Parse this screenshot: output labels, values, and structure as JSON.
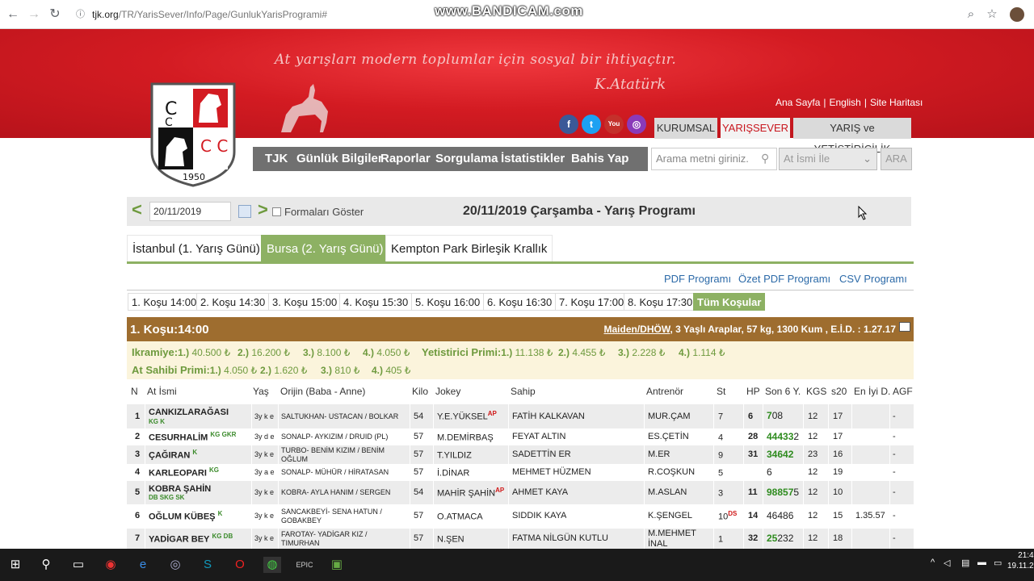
{
  "browser": {
    "url_host": "tjk.org",
    "url_path": "/TR/YarisSever/Info/Page/GunlukYarisProgrami#",
    "watermark": "www.BANDICAM.com"
  },
  "banner": {
    "slogan": "At yarışları modern toplumlar için sosyal bir ihtiyaçtır.",
    "signature": "K.Atatürk",
    "top_links": [
      "Ana Sayfa",
      "English",
      "Site Haritası"
    ],
    "social": [
      "f",
      "t",
      "You Tube",
      "◎"
    ],
    "site_tabs": [
      "KURUMSAL",
      "YARIŞSEVER",
      "YARIŞ ve YETİŞTİRİCİLİK"
    ],
    "logo_year": "1950"
  },
  "colors": {
    "brand_red": "#d31b22",
    "green": "#8db163",
    "race_head": "#9e6d2f"
  },
  "main_nav": [
    "TJK",
    "Günlük Bilgiler",
    "Raporlar",
    "Sorgulama",
    "İstatistikler",
    "Bahis Yap"
  ],
  "search": {
    "placeholder": "Arama metni giriniz.",
    "select_value": "At İsmi İle",
    "button": "ARA"
  },
  "datebar": {
    "date": "20/11/2019",
    "checkbox_label": "Formaları Göster",
    "title": "20/11/2019 Çarşamba - Yarış Programı"
  },
  "city_tabs": [
    "İstanbul (1. Yarış Günü)",
    "Bursa (2. Yarış Günü)",
    "Kempton Park Birleşik Krallık"
  ],
  "program_links": [
    "PDF Programı",
    "Özet PDF Programı",
    "CSV Programı"
  ],
  "race_tabs": [
    "1. Koşu 14:00",
    "2. Koşu 14:30",
    "3. Koşu 15:00",
    "4. Koşu 15:30",
    "5. Koşu 16:00",
    "6. Koşu 16:30",
    "7. Koşu 17:00",
    "8. Koşu 17:30",
    "Tüm Koşular"
  ],
  "race": {
    "name": "1. Koşu:14:00",
    "category": "Maiden/DHÖW",
    "info": ", 3 Yaşlı Araplar, 57 kg, 1300 Kum , E.İ.D. : 1.27.17"
  },
  "prizes": {
    "ikramiye_label": "Ikramiye:",
    "ikramiye": [
      [
        "1.)",
        "40.500 ₺"
      ],
      [
        "2.)",
        "16.200 ₺"
      ],
      [
        "3.)",
        "8.100 ₺"
      ],
      [
        "4.)",
        "4.050 ₺"
      ]
    ],
    "yetistirici_label": "Yetistirici Primi:",
    "yetistirici": [
      [
        "1.)",
        "11.138 ₺"
      ],
      [
        "2.)",
        "4.455 ₺"
      ],
      [
        "3.)",
        "2.228 ₺"
      ],
      [
        "4.)",
        "1.114 ₺"
      ]
    ],
    "sahip_label": "At Sahibi Primi:",
    "sahip": [
      [
        "1.)",
        "4.050 ₺"
      ],
      [
        "2.)",
        "1.620 ₺"
      ],
      [
        "3.)",
        "810 ₺"
      ],
      [
        "4.)",
        "405 ₺"
      ]
    ]
  },
  "table": {
    "headers": [
      "N",
      "At İsmi",
      "Yaş",
      "Orijin (Baba - Anne)",
      "Kilo",
      "Jokey",
      "Sahip",
      "Antrenör",
      "St",
      "HP",
      "Son 6 Y.",
      "KGS",
      "s20",
      "En İyi D.",
      "AGF"
    ],
    "rows": [
      {
        "n": "1",
        "name": "CANKIZLARAĞASI",
        "tags": "KG K",
        "tag_below": true,
        "yas": "3y k e",
        "orijin": "SALTUKHAN- USTACAN / BOLKAR",
        "kilo": "54",
        "jokey": "Y.E.YÜKSEL",
        "jokey_sup": "AP",
        "sahip": "FATİH KALKAVAN",
        "antrenor": "MUR.ÇAM",
        "st": "7",
        "st_sup": "",
        "hp": "6",
        "son6_g": "7",
        "son6": "08",
        "kgs": "12",
        "s20": "17",
        "eniyi": "",
        "agf": "-"
      },
      {
        "n": "2",
        "name": "CESURHALİM",
        "tags": "KG GKR",
        "tag_below": false,
        "yas": "3y d e",
        "orijin": "SONALP- AYKIZIM / DRUID (PL)",
        "kilo": "57",
        "jokey": "M.DEMİRBAŞ",
        "jokey_sup": "",
        "sahip": "FEYAT ALTIN",
        "antrenor": "ES.ÇETİN",
        "st": "4",
        "st_sup": "",
        "hp": "28",
        "son6_g": "44433",
        "son6": "2",
        "kgs": "12",
        "s20": "17",
        "eniyi": "",
        "agf": "-"
      },
      {
        "n": "3",
        "name": "ÇAĞIRAN",
        "tags": "K",
        "tag_below": false,
        "yas": "3y k e",
        "orijin": "TURBO- BENİM KIZIM / BENİM OĞLUM",
        "kilo": "57",
        "jokey": "T.YILDIZ",
        "jokey_sup": "",
        "sahip": "SADETTİN ER",
        "antrenor": "M.ER",
        "st": "9",
        "st_sup": "",
        "hp": "31",
        "son6_g": "34642",
        "son6": "",
        "kgs": "23",
        "s20": "16",
        "eniyi": "",
        "agf": "-"
      },
      {
        "n": "4",
        "name": "KARLEOPARI",
        "tags": "KG",
        "tag_below": false,
        "yas": "3y a e",
        "orijin": "SONALP- MÜHÜR / HİRATASAN",
        "kilo": "57",
        "jokey": "İ.DİNAR",
        "jokey_sup": "",
        "sahip": "MEHMET HÜZMEN",
        "antrenor": "R.COŞKUN",
        "st": "5",
        "st_sup": "",
        "hp": "",
        "son6_g": "",
        "son6": "6",
        "kgs": "12",
        "s20": "19",
        "eniyi": "",
        "agf": "-"
      },
      {
        "n": "5",
        "name": "KOBRA ŞAHİN",
        "tags": "DB SKG SK",
        "tag_below": true,
        "yas": "3y k e",
        "orijin": "KOBRA- AYLA HANIM / SERGEN",
        "kilo": "54",
        "jokey": "MAHİR ŞAHİN",
        "jokey_sup": "AP",
        "sahip": "AHMET KAYA",
        "antrenor": "M.ASLAN",
        "st": "3",
        "st_sup": "",
        "hp": "11",
        "son6_g": "98857",
        "son6": "5",
        "kgs": "12",
        "s20": "10",
        "eniyi": "",
        "agf": "-"
      },
      {
        "n": "6",
        "name": "OĞLUM KÜBEŞ",
        "tags": "K",
        "tag_below": false,
        "yas": "3y k e",
        "orijin": "SANCAKBEYİ- SENA HATUN / GOBAKBEY",
        "kilo": "57",
        "jokey": "O.ATMACA",
        "jokey_sup": "",
        "sahip": "SIDDIK KAYA",
        "antrenor": "K.ŞENGEL",
        "st": "10",
        "st_sup": "DS",
        "hp": "14",
        "son6_g": "",
        "son6": "46486",
        "kgs": "12",
        "s20": "15",
        "eniyi": "1.35.57",
        "agf": "-"
      },
      {
        "n": "7",
        "name": "YADİGAR BEY",
        "tags": "KG DB",
        "tag_below": false,
        "yas": "3y k e",
        "orijin": "FAROTAY- YADİGAR KIZ / TIMURHAN",
        "kilo": "57",
        "jokey": "N.ŞEN",
        "jokey_sup": "",
        "sahip": "FATMA NİLGÜN KUTLU",
        "antrenor": "M.MEHMET İNAL",
        "st": "1",
        "st_sup": "",
        "hp": "32",
        "son6_g": "25",
        "son6": "232",
        "kgs": "12",
        "s20": "18",
        "eniyi": "",
        "agf": "-"
      }
    ]
  },
  "taskbar": {
    "clock_time": "21:4",
    "clock_date": "19.11.2"
  }
}
